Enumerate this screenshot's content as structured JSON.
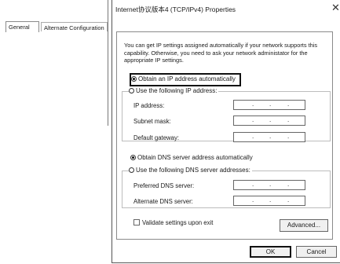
{
  "window": {
    "title": "Internet协议版本4 (TCP/IPv4) Properties",
    "close_glyph": "✕"
  },
  "tabs": [
    {
      "label": "General",
      "active": true
    },
    {
      "label": "Alternate Configuration",
      "active": false
    }
  ],
  "description": "You can get IP settings assigned automatically if your network supports this capability. Otherwise, you need to ask your network administator for the appropriate IP settings.",
  "ip_section": {
    "auto_label": "Obtain an IP address automatically",
    "manual_label": "Use the following IP address:",
    "selected": "auto",
    "fields": [
      {
        "label": "IP address:",
        "value": ". . ."
      },
      {
        "label": "Subnet mask:",
        "value": ". . ."
      },
      {
        "label": "Default gateway:",
        "value": ". . ."
      }
    ]
  },
  "dns_section": {
    "auto_label": "Obtain DNS server address automatically",
    "manual_label": "Use the following DNS server addresses:",
    "selected": "auto",
    "fields": [
      {
        "label": "Preferred DNS server:",
        "value": ". . ."
      },
      {
        "label": "Alternate DNS server:",
        "value": ". . ."
      }
    ]
  },
  "validate_label": "Validate settings upon exit",
  "validate_checked": false,
  "buttons": {
    "advanced": "Advanced...",
    "ok": "OK",
    "cancel": "Cancel"
  }
}
